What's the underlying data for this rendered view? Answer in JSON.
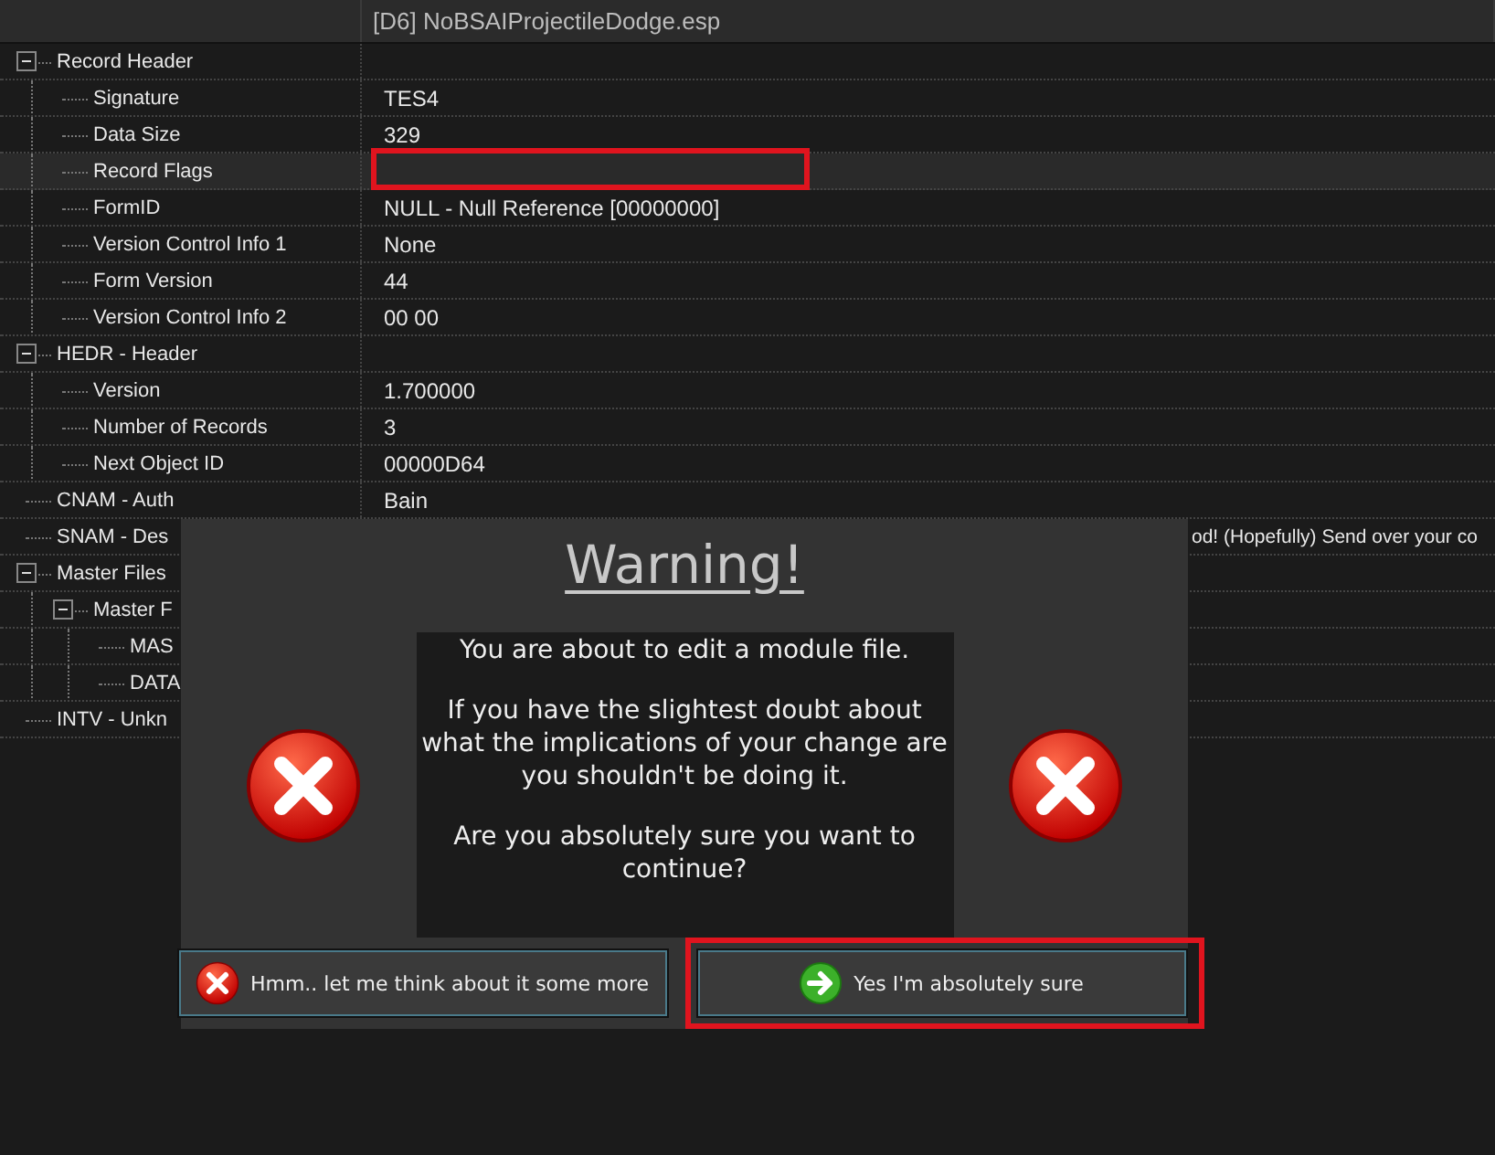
{
  "header": {
    "title": "[D6] NoBSAIProjectileDodge.esp"
  },
  "tree": [
    {
      "label": "Record Header",
      "expanded": true,
      "selected": false,
      "children": [
        {
          "label": "Signature",
          "value": "TES4",
          "selected": false
        },
        {
          "label": "Data Size",
          "value": "329",
          "selected": false
        },
        {
          "label": "Record Flags",
          "selected": true,
          "highlighted": true
        },
        {
          "label": "FormID",
          "value": "NULL - Null Reference [00000000]",
          "selected": false
        },
        {
          "label": "Version Control Info 1",
          "value": "None",
          "selected": false
        },
        {
          "label": "Form Version",
          "value": "44",
          "selected": false
        },
        {
          "label": "Version Control Info 2",
          "value": "00 00",
          "selected": false
        }
      ]
    },
    {
      "label": "HEDR - Header",
      "expanded": true,
      "selected": false,
      "children": [
        {
          "label": "Version",
          "value": "1.700000",
          "selected": false
        },
        {
          "label": "Number of Records",
          "value": "3",
          "selected": false
        },
        {
          "label": "Next Object ID",
          "value": "00000D64",
          "selected": false
        }
      ]
    },
    {
      "label": "CNAM - Auth",
      "value": "Bain",
      "selected": false
    },
    {
      "label": "SNAM - Des",
      "value": "od! (Hopefully) Send over your co",
      "value_cut_left": true,
      "selected": false
    },
    {
      "label": "Master Files",
      "expanded": true,
      "selected": false,
      "children": [
        {
          "label": "Master F",
          "expanded": true,
          "selected": false,
          "children": [
            {
              "label": "MAS",
              "selected": false
            },
            {
              "label": "DATA",
              "selected": false
            }
          ]
        }
      ]
    },
    {
      "label": "INTV - Unkn",
      "selected": false
    }
  ],
  "dialog": {
    "title": "Warning!",
    "messages": [
      "You are about to edit a module file.",
      "If you have the slightest doubt about what the implications of your change are you shouldn't be doing it.",
      "Are you absolutely sure you want to continue?"
    ],
    "buttons": [
      {
        "label": "Hmm.. let me think about it some more",
        "kind": "cancel",
        "highlighted": false
      },
      {
        "label": "Yes I'm absolutely sure",
        "kind": "confirm",
        "highlighted": true
      }
    ]
  }
}
